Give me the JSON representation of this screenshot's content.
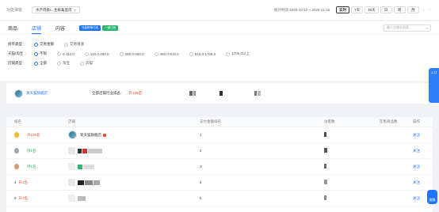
{
  "topbar": {
    "breadcrumb": "功能弹窗",
    "category": "水产肉类/...生鲜禽蛋肉",
    "stat_time": "统计时间 2025-10-10 ~ 2025-11-16",
    "ranges": [
      "实时",
      "7天",
      "30天",
      "日",
      "周",
      "月"
    ],
    "active_range": "实时"
  },
  "tabs": {
    "items": [
      "商品",
      "店铺",
      "内容"
    ],
    "active": "店铺",
    "badges": [
      "流量榜单订阅",
      "一键订阅"
    ],
    "search_placeholder": "输入店铺名搜索"
  },
  "filters": {
    "rows": [
      {
        "label": "榜单类型",
        "options": [
          "交易金额",
          "交易增速"
        ],
        "selected": 0
      },
      {
        "label": "天猫/淘宝",
        "options": [
          "不限",
          "0-110.0",
          "110.0-280.0",
          "280.0-460.0",
          "460.0-815.0",
          "815.0-1705.0",
          "1705.0以上"
        ],
        "selected": 0
      },
      {
        "label": "店铺类型",
        "options": [
          "全部",
          "淘宝",
          "天猫"
        ],
        "selected": 0
      }
    ]
  },
  "summary": {
    "shop_name": "某天猫旗舰店",
    "rank_label": "全部店铺行业排名：",
    "rank_value": "升125名"
  },
  "table": {
    "headers": [
      "排名",
      "店铺",
      "支付金额排名",
      "访客数",
      "在售商品数",
      "操作"
    ],
    "rows": [
      {
        "rank": "升125名",
        "dir": "down",
        "medal": "gold",
        "shop": "某天猫旗舰店",
        "pay_rank": "1",
        "op": "关注"
      },
      {
        "rank": "持1名",
        "dir": "up",
        "medal": "silver",
        "shop": "",
        "pay_rank": "2",
        "op": "关注"
      },
      {
        "rank": "持1名",
        "dir": "up",
        "medal": "bronze",
        "shop": "",
        "pay_rank": "3",
        "op": "关注"
      },
      {
        "rank_num": "4",
        "rank": "升1名",
        "dir": "down",
        "shop": "",
        "pay_rank": "4",
        "op": "关注"
      },
      {
        "rank_num": "5",
        "rank": "升3名",
        "dir": "down",
        "shop": "",
        "pay_rank": "5",
        "op": "关注"
      }
    ]
  },
  "floats": {
    "helper_label": "入口",
    "chat_label": "客服"
  },
  "colors": {
    "accent": "#1e74ff",
    "up": "#2db56d",
    "down": "#f24a34"
  }
}
